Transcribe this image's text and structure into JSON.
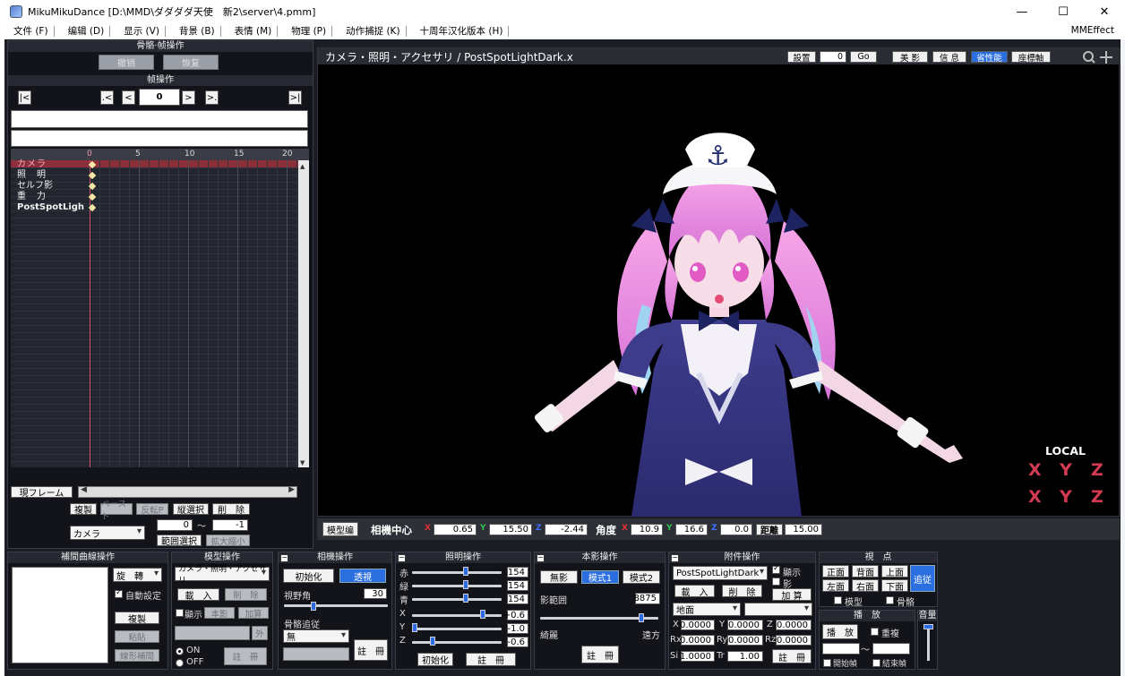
{
  "window": {
    "title": "MikuMikuDance [D:\\MMD\\ダダダダ天使　新2\\server\\4.pmm]"
  },
  "menu": [
    "文件 (F)",
    "编辑 (D)",
    "显示 (V)",
    "背景 (B)",
    "表情 (M)",
    "物理 (P)",
    "动作捕捉 (K)",
    "十周年汉化版本 (H)"
  ],
  "menu_right": "MMEffect",
  "left": {
    "bone_frame_header": "骨骼·帧操作",
    "undo": "撤销",
    "redo": "恢复",
    "frame_header": "帧操作",
    "frame_value": "0",
    "nav": {
      "first": "|<",
      "prev_key": ".<",
      "prev": "<",
      "next": ">",
      "next_key": ">.",
      "last": ">|"
    },
    "ticks": [
      "0",
      "5",
      "10",
      "15",
      "20"
    ],
    "tracks": [
      "カメラ",
      "照　明",
      "セルフ影",
      "重　力",
      "PostSpotLigh"
    ],
    "cur_frame_btn": "現フレーム",
    "copy": "複製",
    "paste": "ペースト",
    "reverse": "反転P",
    "col_select": "縦選択",
    "delete": "削　除",
    "range_from": "0",
    "tilde": "～",
    "range_to": "-1",
    "track_select": "カメラ",
    "range_select": "範囲選択",
    "expand": "拡大縮小"
  },
  "viewport": {
    "title": "カメラ・照明・アクセサリ / PostSpotLightDark.x",
    "setting": "設置",
    "frame_input": "0",
    "go": "Go",
    "shadow": "美 影",
    "info": "信 息",
    "perf": "省性能",
    "axis": "座標軸",
    "local": "LOCAL",
    "local_icons": [
      "X",
      "Y",
      "Z",
      "X",
      "Y",
      "Z"
    ],
    "colors": {
      "accent": "#2a6ee0",
      "track_highlight": "#8b2f3a"
    }
  },
  "coord": {
    "model_edit": "模型编",
    "center_label": "相機中心",
    "x": "0.65",
    "y": "15.50",
    "z": "-2.44",
    "angle_label": "角度",
    "ax": "10.9",
    "ay": "16.6",
    "az": "0.0",
    "dist_label": "距離",
    "dist": "15.00",
    "axis_x": "X",
    "axis_y": "Y",
    "axis_z": "Z"
  },
  "interp": {
    "header": "補間曲線操作",
    "select": "旋　轉",
    "auto": "自動設定",
    "copy": "複製",
    "paste": "粘貼",
    "linear": "線形補間"
  },
  "model_op": {
    "header": "模型操作",
    "select": "カメラ・照明・アクセサリ",
    "load": "載　入",
    "delete": "削　除",
    "show": "顯示",
    "copy_shadow": "本影",
    "add": "加算",
    "out": "外",
    "on": "ON",
    "off": "OFF",
    "register": "註　冊"
  },
  "camera_op": {
    "header": "相機操作",
    "init": "初始化",
    "persp": "透視",
    "fov_label": "視野角",
    "fov": "30",
    "bone_follow": "骨骼追従",
    "follow_select": "無",
    "register": "註　冊"
  },
  "light_op": {
    "header": "照明操作",
    "r_label": "赤",
    "g_label": "緑",
    "b_label": "青",
    "r": "154",
    "g": "154",
    "b": "154",
    "x_label": "X",
    "y_label": "Y",
    "z_label": "Z",
    "x": "+0.6",
    "y": "-1.0",
    "z": "-0.6",
    "init": "初始化",
    "register": "註　冊"
  },
  "shadow_op": {
    "header": "本影操作",
    "none": "無影",
    "mode1": "模式1",
    "mode2": "模式2",
    "range_label": "影範囲",
    "range": "8875",
    "near": "綺麗",
    "far": "遠方",
    "register": "註　冊"
  },
  "acc_op": {
    "header": "附件操作",
    "select": "PostSpotLightDark",
    "show": "顯示",
    "shadow": "影",
    "load": "載　入",
    "delete": "削　除",
    "add": "加 算",
    "ground": "地面",
    "x_label": "X",
    "y_label": "Y",
    "z_label": "Z",
    "rx_label": "Rx",
    "ry_label": "Ry",
    "rz_label": "Rz",
    "si_label": "Si",
    "tr_label": "Tr",
    "x": "0.0000",
    "y": "0.0000",
    "z": "0.0000",
    "rx": "0.0000",
    "ry": "0.0000",
    "rz": "0.0000",
    "si": "1.0000",
    "tr": "1.00",
    "register": "註　冊"
  },
  "view_op": {
    "header": "視　点",
    "front": "正面",
    "back": "背面",
    "top": "上面",
    "follow": "追従",
    "left": "左面",
    "right": "右面",
    "bottom": "下面",
    "model": "模型",
    "bone": "骨骼"
  },
  "play_op": {
    "header": "播　放",
    "play": "播　放",
    "repeat": "重複",
    "tilde": "～",
    "start": "開始幀",
    "end": "結束幀"
  },
  "volume": {
    "header": "音量"
  }
}
